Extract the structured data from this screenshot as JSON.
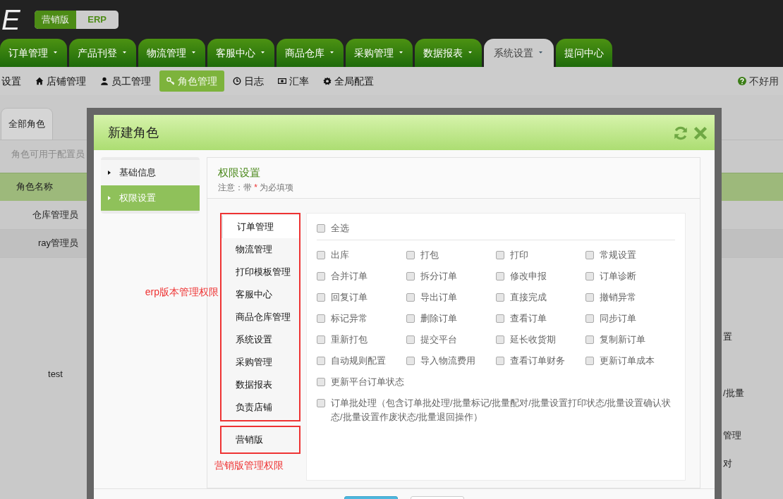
{
  "logo": "E",
  "editions": [
    {
      "label": "营销版",
      "selected": true
    },
    {
      "label": "ERP",
      "selected": false
    }
  ],
  "main_nav": [
    {
      "label": "订单管理",
      "dropdown": true,
      "selected": false
    },
    {
      "label": "产品刊登",
      "dropdown": true,
      "selected": false
    },
    {
      "label": "物流管理",
      "dropdown": true,
      "selected": false
    },
    {
      "label": "客服中心",
      "dropdown": true,
      "selected": false
    },
    {
      "label": "商品仓库",
      "dropdown": true,
      "selected": false
    },
    {
      "label": "采购管理",
      "dropdown": true,
      "selected": false
    },
    {
      "label": "数据报表",
      "dropdown": true,
      "selected": false
    },
    {
      "label": "系统设置",
      "dropdown": true,
      "selected": true
    },
    {
      "label": "提问中心",
      "dropdown": false,
      "selected": false
    }
  ],
  "sub_nav": [
    {
      "label": "设置",
      "selected": false
    },
    {
      "label": "店铺管理",
      "selected": false
    },
    {
      "label": "员工管理",
      "selected": false
    },
    {
      "label": "角色管理",
      "selected": true
    },
    {
      "label": "日志",
      "selected": false
    },
    {
      "label": "汇率",
      "selected": false
    },
    {
      "label": "全局配置",
      "selected": false
    }
  ],
  "help_link": "不好用",
  "page": {
    "tabs": [
      {
        "label": "全部角色",
        "selected": true
      }
    ],
    "hint": "角色可用于配置员",
    "table": {
      "columns": [
        "角色名称"
      ],
      "rows": [
        {
          "name": "仓库管理员"
        },
        {
          "name": "ray管理员"
        },
        {
          "name": "test",
          "column_2_lines": [
            "置",
            "/批量",
            "管理",
            "对"
          ]
        }
      ]
    }
  },
  "dialog": {
    "title": "新建角色",
    "steps": [
      {
        "label": "基础信息",
        "selected": false
      },
      {
        "label": "权限设置",
        "selected": true
      }
    ],
    "section_title": "权限设置",
    "note": {
      "prefix": "注意：带",
      "required_mark": "*",
      "suffix": "为必填项"
    },
    "module_groups": [
      {
        "annotation": "erp版本管理权限",
        "kind": "left-note",
        "modules": [
          {
            "label": "订单管理",
            "selected": true
          },
          {
            "label": "物流管理",
            "selected": false
          },
          {
            "label": "打印模板管理",
            "selected": false
          },
          {
            "label": "客服中心",
            "selected": false
          },
          {
            "label": "商品仓库管理",
            "selected": false
          },
          {
            "label": "系统设置",
            "selected": false
          },
          {
            "label": "采购管理",
            "selected": false
          },
          {
            "label": "数据报表",
            "selected": false
          },
          {
            "label": "负责店铺",
            "selected": false
          }
        ]
      },
      {
        "annotation": "营销版管理权限",
        "kind": "below-note",
        "modules": [
          {
            "label": "营销版",
            "selected": false
          }
        ]
      }
    ],
    "select_all": {
      "label": "全选",
      "checked": false
    },
    "permissions": [
      {
        "label": "出库",
        "checked": false,
        "kind": "cell"
      },
      {
        "label": "打包",
        "checked": false,
        "kind": "cell"
      },
      {
        "label": "打印",
        "checked": false,
        "kind": "cell"
      },
      {
        "label": "常规设置",
        "checked": false,
        "kind": "cell"
      },
      {
        "label": "合并订单",
        "checked": false,
        "kind": "cell"
      },
      {
        "label": "拆分订单",
        "checked": false,
        "kind": "cell"
      },
      {
        "label": "修改申报",
        "checked": false,
        "kind": "cell"
      },
      {
        "label": "订单诊断",
        "checked": false,
        "kind": "cell"
      },
      {
        "label": "回复订单",
        "checked": false,
        "kind": "cell"
      },
      {
        "label": "导出订单",
        "checked": false,
        "kind": "cell"
      },
      {
        "label": "直接完成",
        "checked": false,
        "kind": "cell"
      },
      {
        "label": "撤销异常",
        "checked": false,
        "kind": "cell"
      },
      {
        "label": "标记异常",
        "checked": false,
        "kind": "cell"
      },
      {
        "label": "删除订单",
        "checked": false,
        "kind": "cell"
      },
      {
        "label": "查看订单",
        "checked": false,
        "kind": "cell"
      },
      {
        "label": "同步订单",
        "checked": false,
        "kind": "cell"
      },
      {
        "label": "重新打包",
        "checked": false,
        "kind": "cell"
      },
      {
        "label": "提交平台",
        "checked": false,
        "kind": "cell"
      },
      {
        "label": "延长收货期",
        "checked": false,
        "kind": "cell"
      },
      {
        "label": "复制新订单",
        "checked": false,
        "kind": "cell"
      },
      {
        "label": "自动规则配置",
        "checked": false,
        "kind": "cell"
      },
      {
        "label": "导入物流费用",
        "checked": false,
        "kind": "cell"
      },
      {
        "label": "查看订单财务",
        "checked": false,
        "kind": "cell"
      },
      {
        "label": "更新订单成本",
        "checked": false,
        "kind": "cell"
      },
      {
        "label": "更新平台订单状态",
        "checked": false,
        "kind": "wide"
      },
      {
        "label": "订单批处理（包含订单批处理/批量标记/批量配对/批量设置打印状态/批量设置确认状态/批量设置作废状态/批量退回操作）",
        "checked": false,
        "kind": "wide"
      }
    ]
  }
}
